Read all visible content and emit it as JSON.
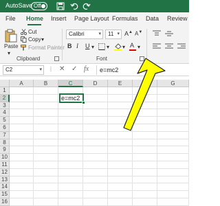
{
  "titlebar": {
    "autosave_label": "AutoSave",
    "toggle_state": "Off",
    "icons": [
      "save-icon",
      "undo-icon",
      "redo-icon"
    ]
  },
  "menu": {
    "tabs": [
      "File",
      "Home",
      "Insert",
      "Page Layout",
      "Formulas",
      "Data",
      "Review"
    ],
    "active": "Home"
  },
  "ribbon": {
    "clipboard": {
      "paste_label": "Paste",
      "cut_label": "Cut",
      "copy_label": "Copy",
      "format_painter_label": "Format Painter",
      "group_label": "Clipboard"
    },
    "font": {
      "font_name": "Calibri",
      "font_size": "11",
      "bold": "B",
      "italic": "I",
      "underline": "U",
      "group_label": "Font",
      "font_color": "#e00000"
    }
  },
  "formula_bar": {
    "name_box": "C2",
    "cancel_icon": "✕",
    "enter_icon": "✓",
    "fx": "fx",
    "content": "e=mc2"
  },
  "grid": {
    "columns": [
      "A",
      "B",
      "C",
      "D",
      "E",
      "F",
      "G"
    ],
    "rows": [
      "1",
      "2",
      "3",
      "4",
      "5",
      "6",
      "7",
      "8",
      "9",
      "10",
      "11",
      "12",
      "13",
      "14",
      "15",
      "16"
    ],
    "selected_column": "C",
    "selected_row": "2",
    "active_cell_value": "e=mc2"
  },
  "colors": {
    "excel_green": "#217346",
    "annotation_yellow": "#ffff00"
  }
}
